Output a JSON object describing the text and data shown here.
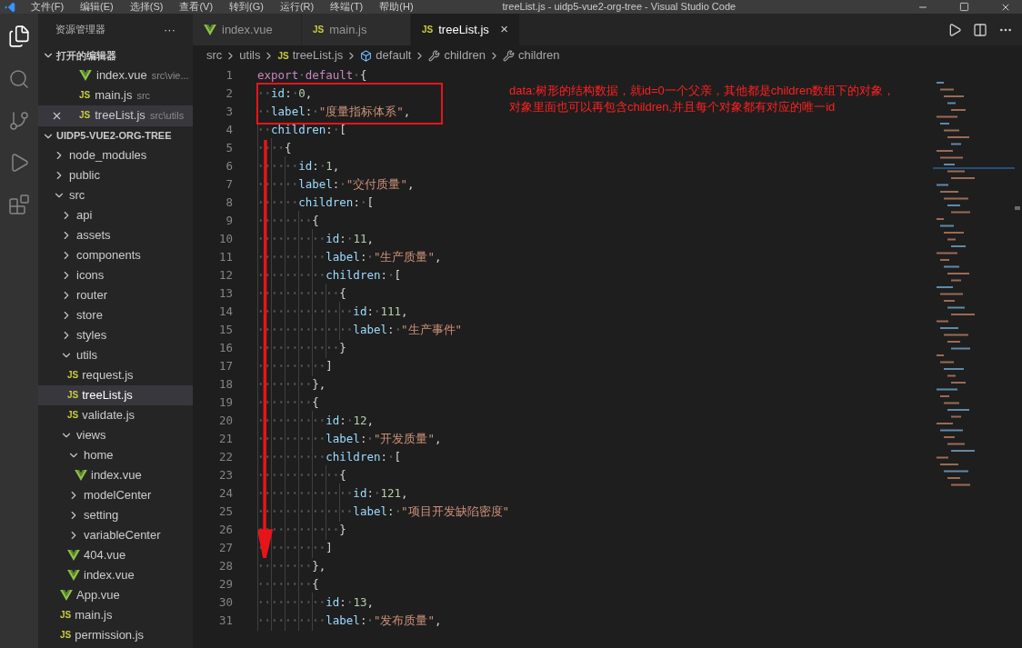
{
  "menu": [
    "文件(F)",
    "编辑(E)",
    "选择(S)",
    "查看(V)",
    "转到(G)",
    "运行(R)",
    "终端(T)",
    "帮助(H)"
  ],
  "window": {
    "title": "treeList.js - uidp5-vue2-org-tree - Visual Studio Code"
  },
  "sidebar": {
    "title": "资源管理器",
    "more": "···",
    "open_editors": {
      "title": "打开的编辑器",
      "expanded": true,
      "items": [
        {
          "kind": "vue",
          "name": "index.vue",
          "path": "src\\vie...",
          "selected": false,
          "close": false
        },
        {
          "kind": "js",
          "badge": "JS",
          "name": "main.js",
          "path": "src",
          "selected": false,
          "close": false
        },
        {
          "kind": "js",
          "badge": "JS",
          "name": "treeList.js",
          "path": "src\\utils",
          "selected": true,
          "close": true
        }
      ]
    },
    "project": {
      "title": "UIDP5-VUE2-ORG-TREE",
      "expanded": true,
      "items": [
        {
          "kind": "folder",
          "name": "node_modules",
          "expanded": false,
          "selected": false
        },
        {
          "kind": "folder",
          "name": "public",
          "expanded": false,
          "selected": false
        },
        {
          "kind": "folder",
          "name": "src",
          "expanded": true,
          "selected": false,
          "children": [
            {
              "kind": "folder",
              "name": "api",
              "expanded": false,
              "selected": false
            },
            {
              "kind": "folder",
              "name": "assets",
              "expanded": false,
              "selected": false
            },
            {
              "kind": "folder",
              "name": "components",
              "expanded": false,
              "selected": false
            },
            {
              "kind": "folder",
              "name": "icons",
              "expanded": false,
              "selected": false
            },
            {
              "kind": "folder",
              "name": "router",
              "expanded": false,
              "selected": false
            },
            {
              "kind": "folder",
              "name": "store",
              "expanded": false,
              "selected": false
            },
            {
              "kind": "folder",
              "name": "styles",
              "expanded": false,
              "selected": false
            },
            {
              "kind": "folder",
              "name": "utils",
              "expanded": true,
              "selected": false,
              "children": [
                {
                  "kind": "js",
                  "badge": "JS",
                  "name": "request.js",
                  "selected": false
                },
                {
                  "kind": "js",
                  "badge": "JS",
                  "name": "treeList.js",
                  "selected": true
                },
                {
                  "kind": "js",
                  "badge": "JS",
                  "name": "validate.js",
                  "selected": false
                }
              ]
            },
            {
              "kind": "folder",
              "name": "views",
              "expanded": true,
              "selected": false,
              "children": [
                {
                  "kind": "folder",
                  "name": "home",
                  "expanded": true,
                  "selected": false,
                  "children": [
                    {
                      "kind": "vue",
                      "name": "index.vue",
                      "selected": false
                    }
                  ]
                },
                {
                  "kind": "folder",
                  "name": "modelCenter",
                  "expanded": false,
                  "selected": false
                },
                {
                  "kind": "folder",
                  "name": "setting",
                  "expanded": false,
                  "selected": false
                },
                {
                  "kind": "folder",
                  "name": "variableCenter",
                  "expanded": false,
                  "selected": false
                },
                {
                  "kind": "vue",
                  "name": "404.vue",
                  "selected": false
                },
                {
                  "kind": "vue",
                  "name": "index.vue",
                  "selected": false
                }
              ]
            },
            {
              "kind": "vue",
              "name": "App.vue",
              "selected": false
            },
            {
              "kind": "js",
              "badge": "JS",
              "name": "main.js",
              "selected": false
            },
            {
              "kind": "js",
              "badge": "JS",
              "name": "permission.js",
              "selected": false
            }
          ]
        }
      ]
    }
  },
  "tabs": [
    {
      "kind": "vue",
      "label": "index.vue",
      "selected": false
    },
    {
      "kind": "js",
      "badge": "JS",
      "label": "main.js",
      "selected": false
    },
    {
      "kind": "js",
      "badge": "JS",
      "label": "treeList.js",
      "selected": true,
      "close": "×"
    }
  ],
  "breadcrumb": [
    {
      "kind": "folder",
      "label": "src"
    },
    {
      "kind": "folder",
      "label": "utils"
    },
    {
      "kind": "js",
      "badge": "JS",
      "label": "treeList.js"
    },
    {
      "kind": "module",
      "label": "default"
    },
    {
      "kind": "property",
      "label": "children"
    },
    {
      "kind": "property",
      "label": "children"
    }
  ],
  "code": [
    {
      "number": "1",
      "tokens": [
        {
          "kind": "kw",
          "text": "export "
        },
        {
          "kind": "kw",
          "text": "default "
        },
        {
          "kind": "punct",
          "text": "{"
        }
      ]
    },
    {
      "number": "2",
      "tokens": [
        {
          "kind": "prop",
          "text": "  id"
        },
        {
          "kind": "punct",
          "text": ": "
        },
        {
          "kind": "num",
          "text": "0"
        },
        {
          "kind": "punct",
          "text": ","
        }
      ]
    },
    {
      "number": "3",
      "tokens": [
        {
          "kind": "prop",
          "text": "  label"
        },
        {
          "kind": "punct",
          "text": ": "
        },
        {
          "kind": "str",
          "text": "\"度量指标体系\""
        },
        {
          "kind": "punct",
          "text": ","
        }
      ]
    },
    {
      "number": "4",
      "tokens": [
        {
          "kind": "prop",
          "text": "  children"
        },
        {
          "kind": "punct",
          "text": ": ["
        }
      ]
    },
    {
      "number": "5",
      "tokens": [
        {
          "kind": "punct",
          "text": "    {"
        }
      ]
    },
    {
      "number": "6",
      "tokens": [
        {
          "kind": "prop",
          "text": "      id"
        },
        {
          "kind": "punct",
          "text": ": "
        },
        {
          "kind": "num",
          "text": "1"
        },
        {
          "kind": "punct",
          "text": ","
        }
      ]
    },
    {
      "number": "7",
      "tokens": [
        {
          "kind": "prop",
          "text": "      label"
        },
        {
          "kind": "punct",
          "text": ": "
        },
        {
          "kind": "str",
          "text": "\"交付质量\""
        },
        {
          "kind": "punct",
          "text": ","
        }
      ]
    },
    {
      "number": "8",
      "tokens": [
        {
          "kind": "prop",
          "text": "      children"
        },
        {
          "kind": "punct",
          "text": ": ["
        }
      ]
    },
    {
      "number": "9",
      "tokens": [
        {
          "kind": "punct",
          "text": "        {"
        }
      ]
    },
    {
      "number": "10",
      "tokens": [
        {
          "kind": "prop",
          "text": "          id"
        },
        {
          "kind": "punct",
          "text": ": "
        },
        {
          "kind": "num",
          "text": "11"
        },
        {
          "kind": "punct",
          "text": ","
        }
      ]
    },
    {
      "number": "11",
      "tokens": [
        {
          "kind": "prop",
          "text": "          label"
        },
        {
          "kind": "punct",
          "text": ": "
        },
        {
          "kind": "str",
          "text": "\"生产质量\""
        },
        {
          "kind": "punct",
          "text": ","
        }
      ]
    },
    {
      "number": "12",
      "tokens": [
        {
          "kind": "prop",
          "text": "          children"
        },
        {
          "kind": "punct",
          "text": ": ["
        }
      ]
    },
    {
      "number": "13",
      "tokens": [
        {
          "kind": "punct",
          "text": "            {"
        }
      ]
    },
    {
      "number": "14",
      "tokens": [
        {
          "kind": "prop",
          "text": "              id"
        },
        {
          "kind": "punct",
          "text": ": "
        },
        {
          "kind": "num",
          "text": "111"
        },
        {
          "kind": "punct",
          "text": ","
        }
      ]
    },
    {
      "number": "15",
      "tokens": [
        {
          "kind": "prop",
          "text": "              label"
        },
        {
          "kind": "punct",
          "text": ": "
        },
        {
          "kind": "str",
          "text": "\"生产事件\""
        }
      ]
    },
    {
      "number": "16",
      "tokens": [
        {
          "kind": "punct",
          "text": "            }"
        }
      ]
    },
    {
      "number": "17",
      "tokens": [
        {
          "kind": "punct",
          "text": "          ]"
        }
      ]
    },
    {
      "number": "18",
      "tokens": [
        {
          "kind": "punct",
          "text": "        },"
        }
      ]
    },
    {
      "number": "19",
      "tokens": [
        {
          "kind": "punct",
          "text": "        {"
        }
      ]
    },
    {
      "number": "20",
      "tokens": [
        {
          "kind": "prop",
          "text": "          id"
        },
        {
          "kind": "punct",
          "text": ": "
        },
        {
          "kind": "num",
          "text": "12"
        },
        {
          "kind": "punct",
          "text": ","
        }
      ]
    },
    {
      "number": "21",
      "tokens": [
        {
          "kind": "prop",
          "text": "          label"
        },
        {
          "kind": "punct",
          "text": ": "
        },
        {
          "kind": "str",
          "text": "\"开发质量\""
        },
        {
          "kind": "punct",
          "text": ","
        }
      ]
    },
    {
      "number": "22",
      "tokens": [
        {
          "kind": "prop",
          "text": "          children"
        },
        {
          "kind": "punct",
          "text": ": ["
        }
      ]
    },
    {
      "number": "23",
      "tokens": [
        {
          "kind": "punct",
          "text": "            {"
        }
      ]
    },
    {
      "number": "24",
      "tokens": [
        {
          "kind": "prop",
          "text": "              id"
        },
        {
          "kind": "punct",
          "text": ": "
        },
        {
          "kind": "num",
          "text": "121"
        },
        {
          "kind": "punct",
          "text": ","
        }
      ]
    },
    {
      "number": "25",
      "tokens": [
        {
          "kind": "prop",
          "text": "              label"
        },
        {
          "kind": "punct",
          "text": ": "
        },
        {
          "kind": "str",
          "text": "\"项目开发缺陷密度\""
        }
      ]
    },
    {
      "number": "26",
      "tokens": [
        {
          "kind": "punct",
          "text": "            }"
        }
      ]
    },
    {
      "number": "27",
      "tokens": [
        {
          "kind": "punct",
          "text": "          ]"
        }
      ]
    },
    {
      "number": "28",
      "tokens": [
        {
          "kind": "punct",
          "text": "        },"
        }
      ]
    },
    {
      "number": "29",
      "tokens": [
        {
          "kind": "punct",
          "text": "        {"
        }
      ]
    },
    {
      "number": "30",
      "tokens": [
        {
          "kind": "prop",
          "text": "          id"
        },
        {
          "kind": "punct",
          "text": ": "
        },
        {
          "kind": "num",
          "text": "13"
        },
        {
          "kind": "punct",
          "text": ","
        }
      ]
    },
    {
      "number": "31",
      "tokens": [
        {
          "kind": "prop",
          "text": "          label"
        },
        {
          "kind": "punct",
          "text": ": "
        },
        {
          "kind": "str",
          "text": "\"发布质量\""
        },
        {
          "kind": "punct",
          "text": ","
        }
      ]
    }
  ],
  "annotation": {
    "lines": [
      "data:树形的结构数据，就id=0一个父亲，其他都是children数组下的对象，",
      "对象里面也可以再包含children,并且每个对象都有对应的唯一id"
    ]
  }
}
